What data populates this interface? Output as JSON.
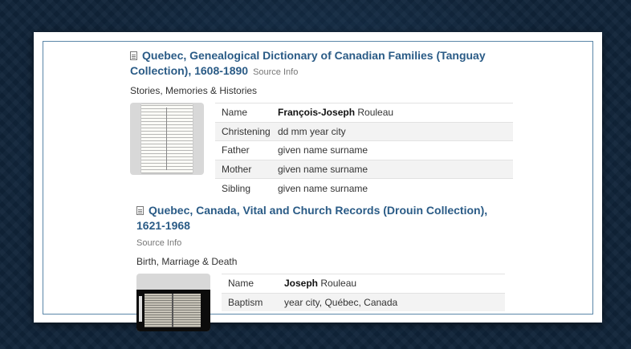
{
  "records": [
    {
      "title": "Quebec, Genealogical Dictionary of Canadian Families (Tanguay Collection), 1608-1890",
      "source_info": "Source Info",
      "category": "Stories, Memories & Histories",
      "fields": [
        {
          "label": "Name",
          "value_bold": "François-Joseph",
          "value": " Rouleau"
        },
        {
          "label": "Christening",
          "value_bold": "",
          "value": "dd mm year city"
        },
        {
          "label": "Father",
          "value_bold": "",
          "value": "given name surname"
        },
        {
          "label": "Mother",
          "value_bold": "",
          "value": "given name surname"
        },
        {
          "label": "Sibling",
          "value_bold": "",
          "value": "given name surname"
        }
      ]
    },
    {
      "title": "Quebec, Canada, Vital and Church Records (Drouin Collection), 1621-1968",
      "source_info": "Source Info",
      "category": "Birth, Marriage & Death",
      "fields": [
        {
          "label": "Name",
          "value_bold": "Joseph",
          "value": " Rouleau"
        },
        {
          "label": "Baptism",
          "value_bold": "",
          "value": "year city, Québec, Canada"
        }
      ]
    }
  ],
  "icons": {
    "record_icon": "document-icon"
  },
  "colors": {
    "title": "#2a5b86",
    "frame": "#5a86a8",
    "background": "#0f2338"
  }
}
